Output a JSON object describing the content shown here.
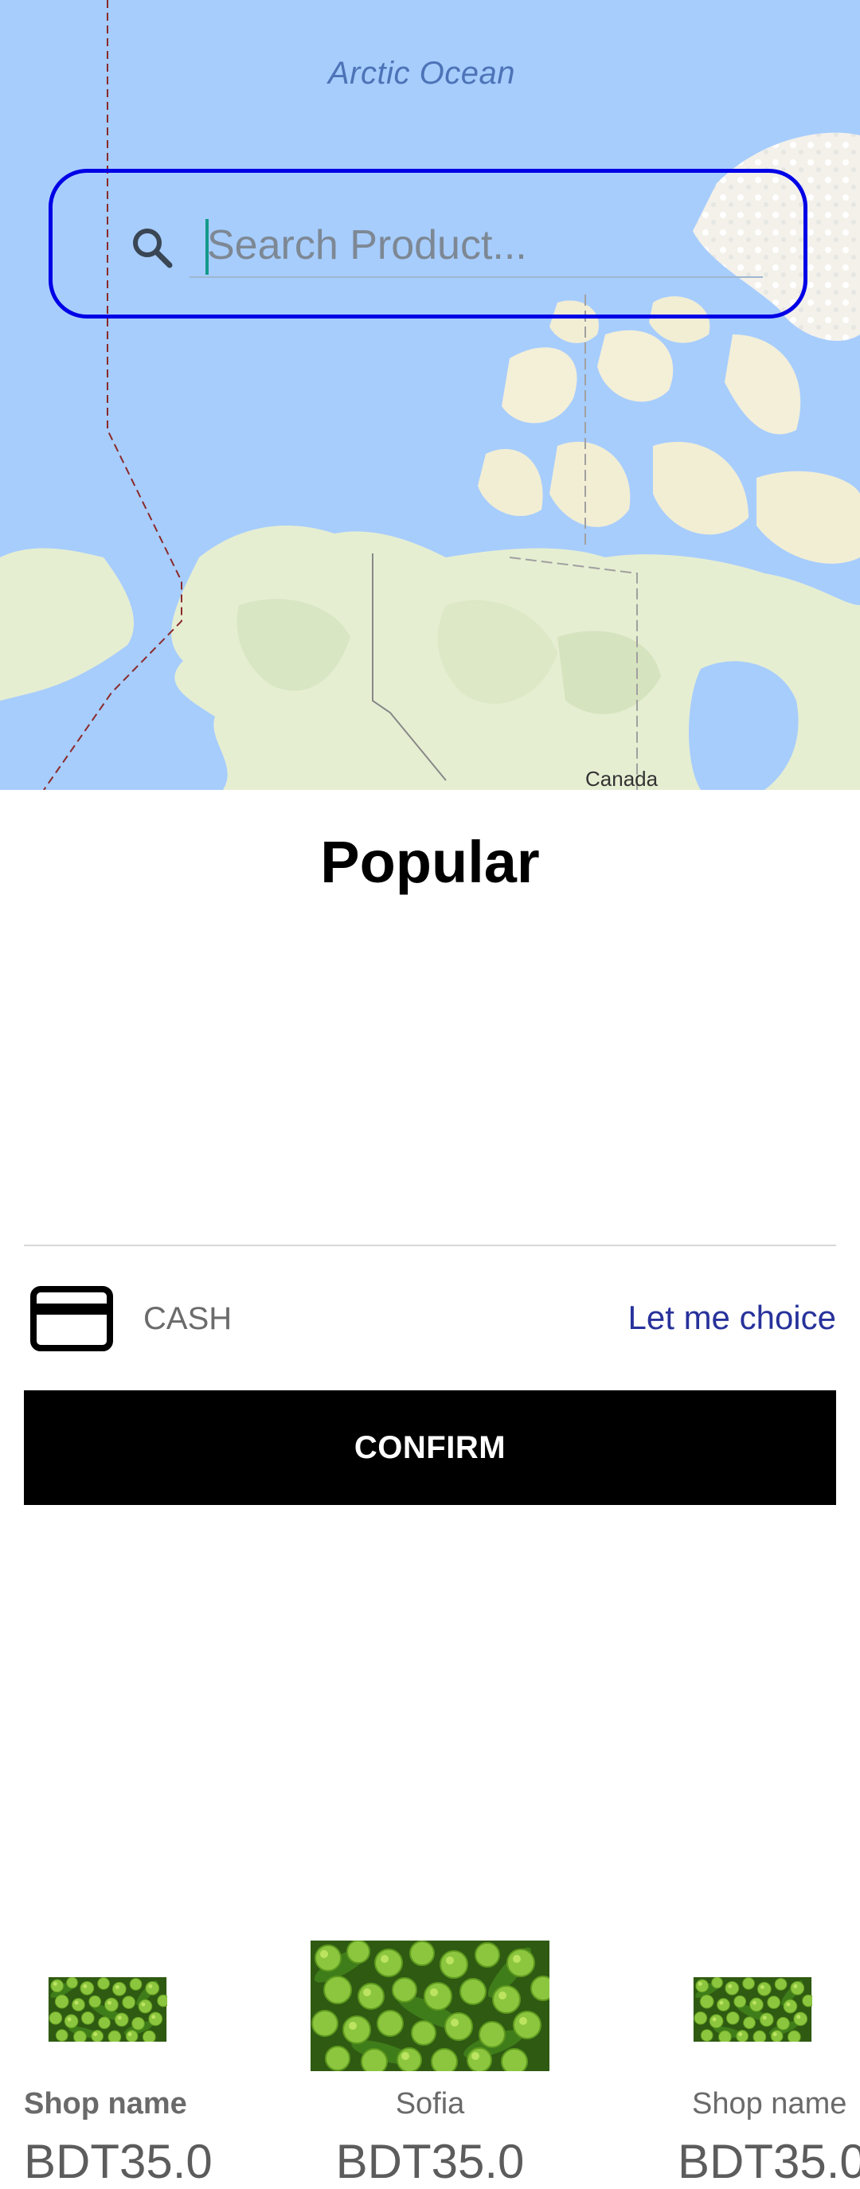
{
  "map": {
    "ocean_label": "Arctic Ocean",
    "country_label": "Canada"
  },
  "search": {
    "placeholder": "Search Product...",
    "value": "",
    "icon": "search-icon"
  },
  "popular": {
    "title": "Popular",
    "products": [
      {
        "shop": "Shop name",
        "price": "BDT35.0",
        "image": "green-fruit-thumbnail"
      },
      {
        "shop": "Sofia",
        "price": "BDT35.0",
        "image": "green-fruit-thumbnail"
      },
      {
        "shop": "Shop name",
        "price": "BDT35.0",
        "image": "green-fruit-thumbnail"
      }
    ]
  },
  "payment": {
    "icon": "credit-card-icon",
    "method": "CASH",
    "choice_link": "Let me choice"
  },
  "confirm": {
    "label": "CONFIRM"
  },
  "colors": {
    "water": "#a7cdfd",
    "land": "#e8f0d8",
    "search_outline": "#0000e6",
    "link": "#27329b",
    "button": "#000000"
  }
}
